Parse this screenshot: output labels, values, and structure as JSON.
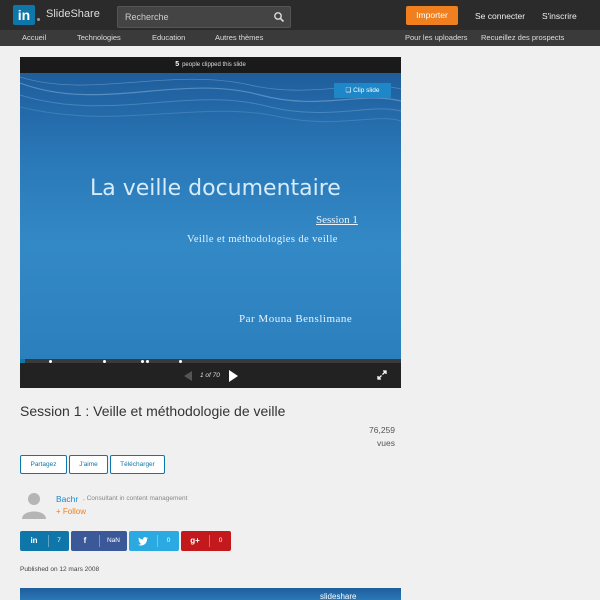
{
  "header": {
    "logo_text": "in",
    "brand": "SlideShare",
    "search_placeholder": "Recherche",
    "import_label": "Importer",
    "login_label": "Se connecter",
    "signup_label": "S'inscrire"
  },
  "nav": {
    "items": [
      "Accueil",
      "Technologies",
      "Education",
      "Autres thèmes"
    ],
    "right_items": [
      "Pour les uploaders",
      "Recueillez des prospects"
    ]
  },
  "player": {
    "clip_count": "5",
    "clip_text": "people clipped this slide",
    "clip_button": "Clip slide",
    "slide_title": "La veille documentaire",
    "slide_session": "Session 1",
    "slide_subtitle": "Veille et méthodologies de veille",
    "slide_author": "Par Mouna Benslimane",
    "page_indicator": "1 of 70",
    "progress_fraction": 0.014
  },
  "doc": {
    "title": "Session 1 : Veille et méthodologie de veille",
    "views_count": "76,259",
    "views_label": "vues"
  },
  "actions": {
    "share_label": "Partagez",
    "like_label": "J'aime",
    "download_label": "Télécharger"
  },
  "author": {
    "name": "Bachr",
    "role": ", Consultant in content management",
    "follow_label": "+ Follow"
  },
  "social": {
    "linkedin_icon": "in",
    "linkedin_count": "7",
    "facebook_icon": "f",
    "facebook_count": "NaN",
    "twitter_count": "0",
    "google_icon": "g+",
    "google_count": "0"
  },
  "published": "Published on 12 mars 2008",
  "next_slide": {
    "brand": "slideshare"
  },
  "colors": {
    "linkedin": "#0e76a8",
    "facebook": "#3b5998",
    "twitter": "#2ba9e1",
    "google": "#c4191c",
    "import": "#f07f20"
  }
}
